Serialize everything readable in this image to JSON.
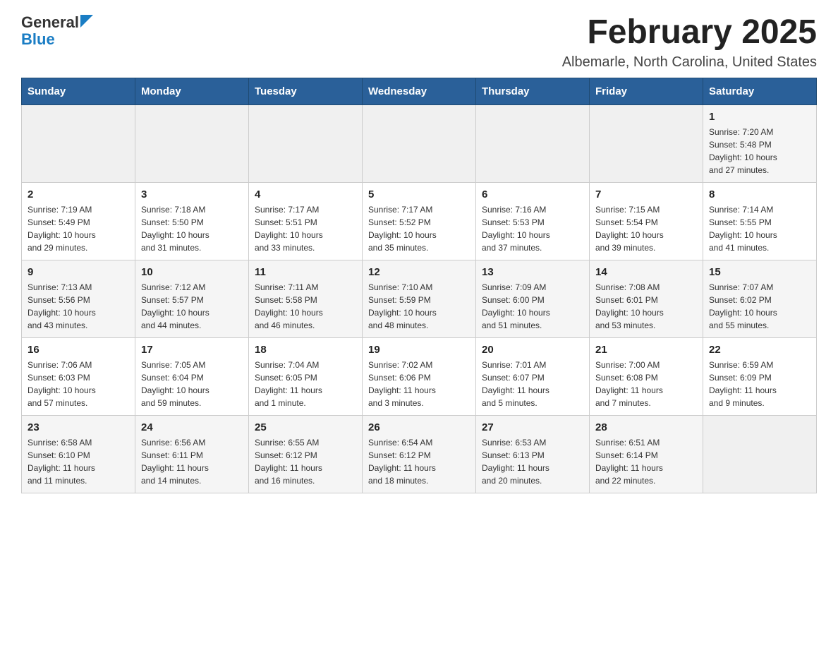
{
  "logo": {
    "general": "General",
    "blue": "Blue"
  },
  "title": "February 2025",
  "location": "Albemarle, North Carolina, United States",
  "days_of_week": [
    "Sunday",
    "Monday",
    "Tuesday",
    "Wednesday",
    "Thursday",
    "Friday",
    "Saturday"
  ],
  "weeks": [
    [
      {
        "day": "",
        "info": ""
      },
      {
        "day": "",
        "info": ""
      },
      {
        "day": "",
        "info": ""
      },
      {
        "day": "",
        "info": ""
      },
      {
        "day": "",
        "info": ""
      },
      {
        "day": "",
        "info": ""
      },
      {
        "day": "1",
        "info": "Sunrise: 7:20 AM\nSunset: 5:48 PM\nDaylight: 10 hours\nand 27 minutes."
      }
    ],
    [
      {
        "day": "2",
        "info": "Sunrise: 7:19 AM\nSunset: 5:49 PM\nDaylight: 10 hours\nand 29 minutes."
      },
      {
        "day": "3",
        "info": "Sunrise: 7:18 AM\nSunset: 5:50 PM\nDaylight: 10 hours\nand 31 minutes."
      },
      {
        "day": "4",
        "info": "Sunrise: 7:17 AM\nSunset: 5:51 PM\nDaylight: 10 hours\nand 33 minutes."
      },
      {
        "day": "5",
        "info": "Sunrise: 7:17 AM\nSunset: 5:52 PM\nDaylight: 10 hours\nand 35 minutes."
      },
      {
        "day": "6",
        "info": "Sunrise: 7:16 AM\nSunset: 5:53 PM\nDaylight: 10 hours\nand 37 minutes."
      },
      {
        "day": "7",
        "info": "Sunrise: 7:15 AM\nSunset: 5:54 PM\nDaylight: 10 hours\nand 39 minutes."
      },
      {
        "day": "8",
        "info": "Sunrise: 7:14 AM\nSunset: 5:55 PM\nDaylight: 10 hours\nand 41 minutes."
      }
    ],
    [
      {
        "day": "9",
        "info": "Sunrise: 7:13 AM\nSunset: 5:56 PM\nDaylight: 10 hours\nand 43 minutes."
      },
      {
        "day": "10",
        "info": "Sunrise: 7:12 AM\nSunset: 5:57 PM\nDaylight: 10 hours\nand 44 minutes."
      },
      {
        "day": "11",
        "info": "Sunrise: 7:11 AM\nSunset: 5:58 PM\nDaylight: 10 hours\nand 46 minutes."
      },
      {
        "day": "12",
        "info": "Sunrise: 7:10 AM\nSunset: 5:59 PM\nDaylight: 10 hours\nand 48 minutes."
      },
      {
        "day": "13",
        "info": "Sunrise: 7:09 AM\nSunset: 6:00 PM\nDaylight: 10 hours\nand 51 minutes."
      },
      {
        "day": "14",
        "info": "Sunrise: 7:08 AM\nSunset: 6:01 PM\nDaylight: 10 hours\nand 53 minutes."
      },
      {
        "day": "15",
        "info": "Sunrise: 7:07 AM\nSunset: 6:02 PM\nDaylight: 10 hours\nand 55 minutes."
      }
    ],
    [
      {
        "day": "16",
        "info": "Sunrise: 7:06 AM\nSunset: 6:03 PM\nDaylight: 10 hours\nand 57 minutes."
      },
      {
        "day": "17",
        "info": "Sunrise: 7:05 AM\nSunset: 6:04 PM\nDaylight: 10 hours\nand 59 minutes."
      },
      {
        "day": "18",
        "info": "Sunrise: 7:04 AM\nSunset: 6:05 PM\nDaylight: 11 hours\nand 1 minute."
      },
      {
        "day": "19",
        "info": "Sunrise: 7:02 AM\nSunset: 6:06 PM\nDaylight: 11 hours\nand 3 minutes."
      },
      {
        "day": "20",
        "info": "Sunrise: 7:01 AM\nSunset: 6:07 PM\nDaylight: 11 hours\nand 5 minutes."
      },
      {
        "day": "21",
        "info": "Sunrise: 7:00 AM\nSunset: 6:08 PM\nDaylight: 11 hours\nand 7 minutes."
      },
      {
        "day": "22",
        "info": "Sunrise: 6:59 AM\nSunset: 6:09 PM\nDaylight: 11 hours\nand 9 minutes."
      }
    ],
    [
      {
        "day": "23",
        "info": "Sunrise: 6:58 AM\nSunset: 6:10 PM\nDaylight: 11 hours\nand 11 minutes."
      },
      {
        "day": "24",
        "info": "Sunrise: 6:56 AM\nSunset: 6:11 PM\nDaylight: 11 hours\nand 14 minutes."
      },
      {
        "day": "25",
        "info": "Sunrise: 6:55 AM\nSunset: 6:12 PM\nDaylight: 11 hours\nand 16 minutes."
      },
      {
        "day": "26",
        "info": "Sunrise: 6:54 AM\nSunset: 6:12 PM\nDaylight: 11 hours\nand 18 minutes."
      },
      {
        "day": "27",
        "info": "Sunrise: 6:53 AM\nSunset: 6:13 PM\nDaylight: 11 hours\nand 20 minutes."
      },
      {
        "day": "28",
        "info": "Sunrise: 6:51 AM\nSunset: 6:14 PM\nDaylight: 11 hours\nand 22 minutes."
      },
      {
        "day": "",
        "info": ""
      }
    ]
  ]
}
